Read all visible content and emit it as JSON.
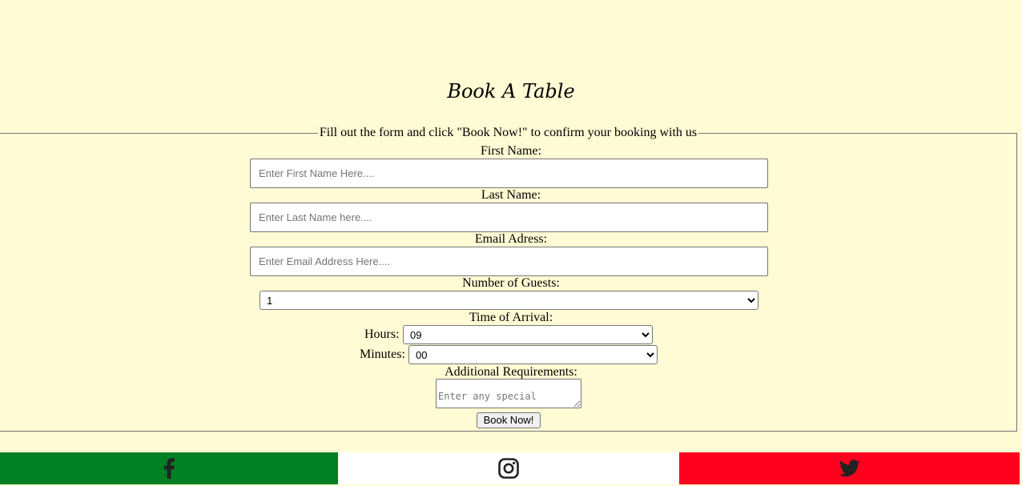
{
  "title": "Book A Table",
  "legend": "Fill out the form and click \"Book Now!\" to confirm your booking with us",
  "fields": {
    "first_name": {
      "label": "First Name:",
      "placeholder": "Enter First Name Here...."
    },
    "last_name": {
      "label": "Last Name:",
      "placeholder": "Enter Last Name here...."
    },
    "email": {
      "label": "Email Adress:",
      "placeholder": "Enter Email Address Here...."
    }
  },
  "guests": {
    "label": "Number of Guests:",
    "value": "1"
  },
  "arrival": {
    "label": "Time of Arrival:",
    "hours_label": "Hours:",
    "hours_value": "09",
    "minutes_label": "Minutes:",
    "minutes_value": "00"
  },
  "requirements": {
    "label": "Additional Requirements:",
    "placeholder": "Enter any special"
  },
  "submit_label": "Book Now!",
  "social": {
    "facebook": {
      "icon": "facebook-icon",
      "color": "#008025"
    },
    "instagram": {
      "icon": "instagram-icon",
      "color": "#ffffff"
    },
    "twitter": {
      "icon": "twitter-icon",
      "color": "#ff001e"
    }
  },
  "colors": {
    "background": "#fffbd4",
    "icon": "#222222"
  }
}
